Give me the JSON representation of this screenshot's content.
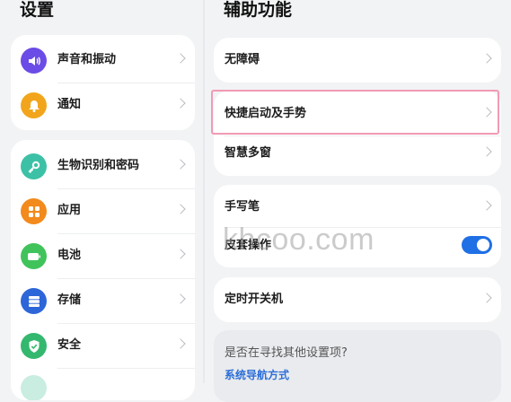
{
  "left_panel": {
    "title": "设置",
    "groups": [
      {
        "items": [
          {
            "label": "声音和振动",
            "icon": "speaker-icon",
            "color": "#6b4ce6"
          },
          {
            "label": "通知",
            "icon": "bell-icon",
            "color": "#f2a51c"
          }
        ]
      },
      {
        "items": [
          {
            "label": "生物识别和密码",
            "icon": "key-icon",
            "color": "#3cc1a6"
          },
          {
            "label": "应用",
            "icon": "apps-grid-icon",
            "color": "#f28a1c"
          },
          {
            "label": "电池",
            "icon": "battery-icon",
            "color": "#41c35b"
          },
          {
            "label": "存储",
            "icon": "storage-icon",
            "color": "#2d66d8"
          },
          {
            "label": "安全",
            "icon": "shield-check-icon",
            "color": "#34b86f"
          }
        ]
      }
    ]
  },
  "right_panel": {
    "title": "辅助功能",
    "items": {
      "accessibility": "无障碍",
      "shortcuts_gestures": "快捷启动及手势",
      "smart_multiwindow": "智慧多窗",
      "stylus": "手写笔",
      "cover_operation": "皮套操作",
      "scheduled_power": "定时开关机"
    },
    "cover_operation_enabled": true,
    "hint": {
      "question": "是否在寻找其他设置项?",
      "link": "系统导航方式"
    }
  },
  "watermark": "khcoo.com",
  "colors": {
    "accent": "#1f6fe5",
    "highlight_border": "#f29ab4",
    "background": "#f1f3f5"
  }
}
